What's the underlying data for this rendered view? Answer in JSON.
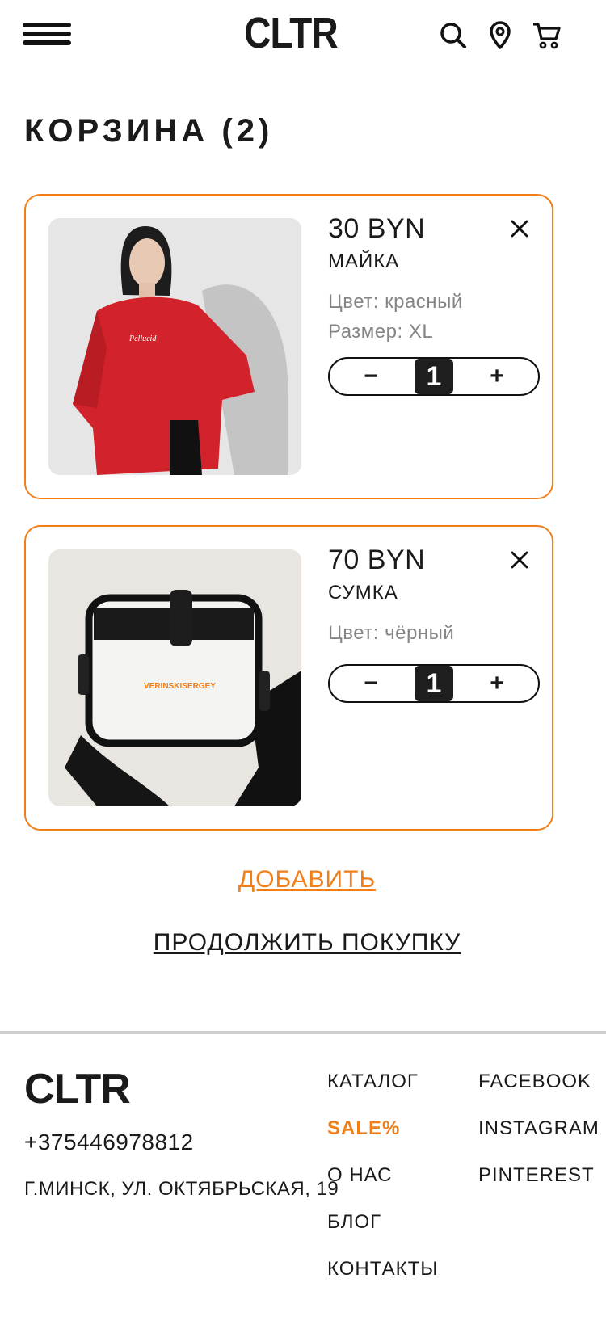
{
  "header": {
    "logo": "CLTR",
    "icons": [
      "menu-icon",
      "search-icon",
      "location-pin-icon",
      "cart-icon"
    ]
  },
  "page": {
    "title": "КОРЗИНА (2)"
  },
  "cart": {
    "items": [
      {
        "price": "30 BYN",
        "name": "МАЙКА",
        "color": "Цвет: красный",
        "size": "Размер: XL",
        "quantity": "1",
        "minus": "−",
        "plus": "+"
      },
      {
        "price": "70 BYN",
        "name": "СУМКА",
        "color": "Цвет: чёрный",
        "bag_print": "VERINSKISERGEY",
        "quantity": "1",
        "minus": "−",
        "plus": "+"
      }
    ]
  },
  "actions": {
    "add": "ДОБАВИТЬ",
    "continue": "ПРОДОЛЖИТЬ ПОКУПКУ"
  },
  "footer": {
    "logo": "CLTR",
    "phone": "+375446978812",
    "address": "Г.МИНСК, УЛ. ОКТЯБРЬСКАЯ, 19",
    "nav": [
      "КАТАЛОГ",
      "SALE%",
      "О НАС",
      "БЛОГ",
      "КОНТАКТЫ"
    ],
    "social": [
      "FACEBOOK",
      "INSTAGRAM",
      "PINTEREST"
    ]
  },
  "colors": {
    "accent": "#f07f1a",
    "text": "#1a1a1a",
    "muted": "#858585"
  }
}
